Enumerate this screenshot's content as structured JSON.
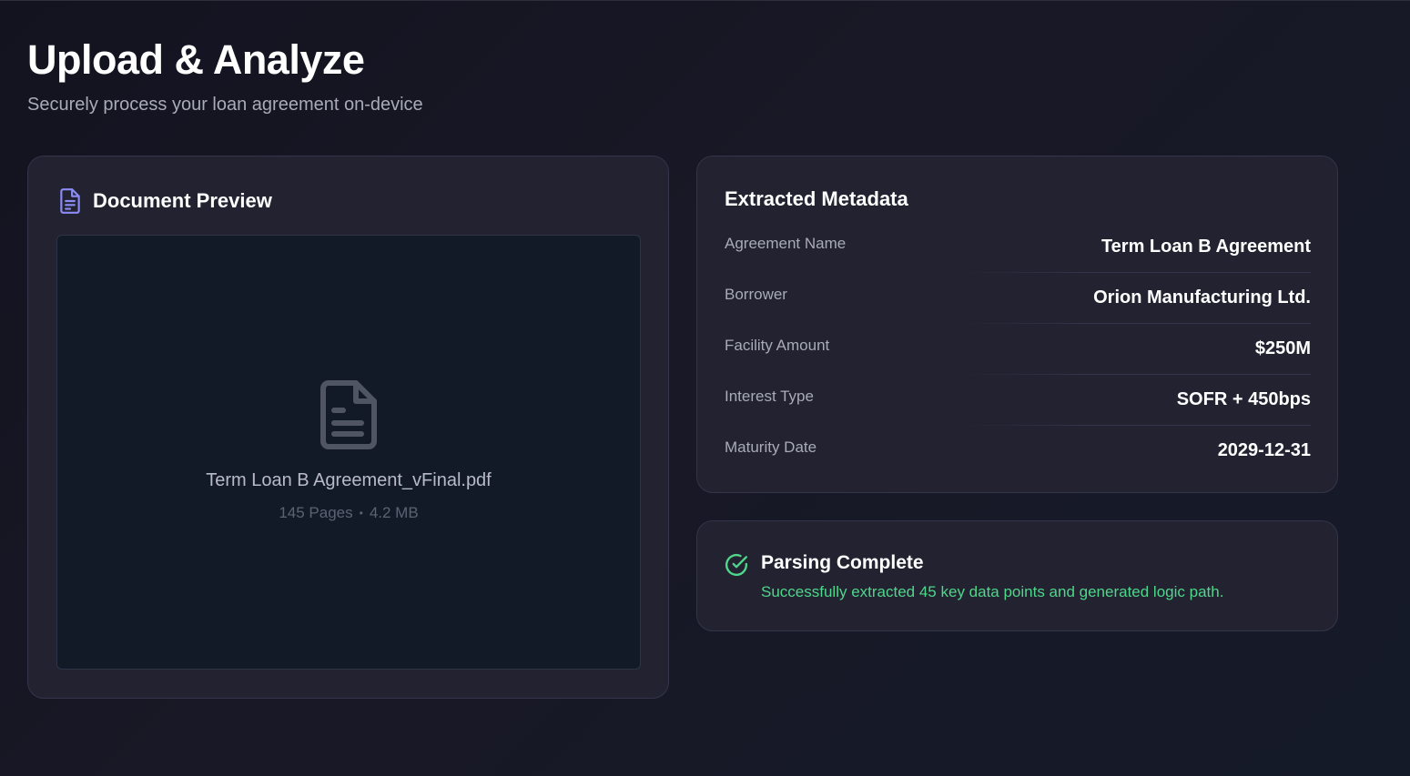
{
  "header": {
    "title": "Upload & Analyze",
    "subtitle": "Securely process your loan agreement on-device"
  },
  "document_preview": {
    "title": "Document Preview",
    "title_icon": "document-icon",
    "file_icon": "file-text-icon",
    "file_name": "Term Loan B Agreement_vFinal.pdf",
    "pages": "145 Pages",
    "separator": "•",
    "size": "4.2 MB"
  },
  "metadata": {
    "title": "Extracted Metadata",
    "rows": [
      {
        "label": "Agreement Name",
        "value": "Term Loan B Agreement"
      },
      {
        "label": "Borrower",
        "value": "Orion Manufacturing Ltd."
      },
      {
        "label": "Facility Amount",
        "value": "$250M"
      },
      {
        "label": "Interest Type",
        "value": "SOFR + 450bps"
      },
      {
        "label": "Maturity Date",
        "value": "2029-12-31"
      }
    ]
  },
  "status": {
    "icon": "check-circle-icon",
    "title": "Parsing Complete",
    "description": "Successfully extracted 45 key data points and generated logic path.",
    "color": "#4fd68a"
  },
  "colors": {
    "accent": "#8b8cf5",
    "success": "#4fd68a",
    "background": "#151521",
    "card": "#222231"
  }
}
